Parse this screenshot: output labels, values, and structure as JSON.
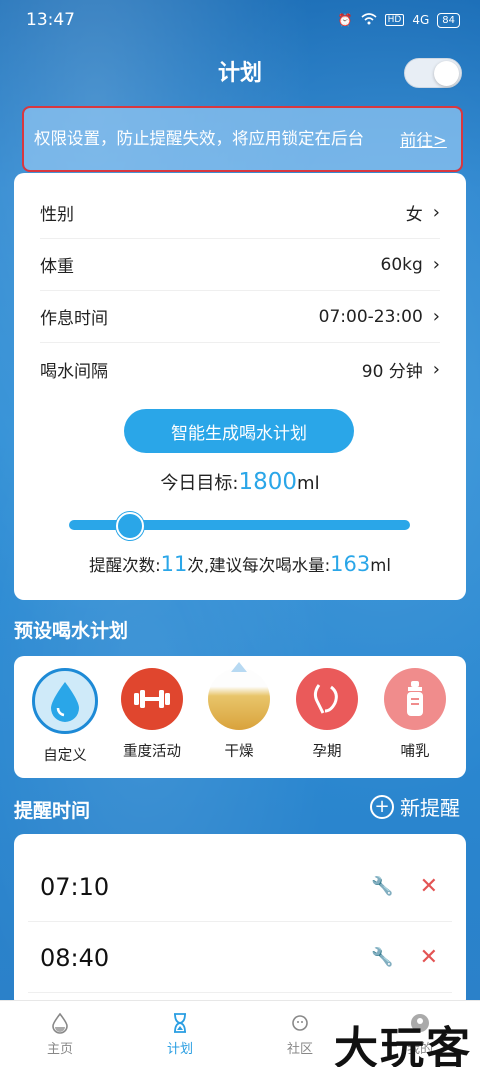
{
  "status_bar": {
    "time": "13:47",
    "network": "4G",
    "battery": "84"
  },
  "header": {
    "title": "计划",
    "toggle_on": true
  },
  "notice": {
    "text": "权限设置，防止提醒失效，将应用锁定在后台",
    "link": "前往>"
  },
  "settings": {
    "rows": [
      {
        "label": "性别",
        "value": "女"
      },
      {
        "label": "体重",
        "value": "60kg"
      },
      {
        "label": "作息时间",
        "value": "07:00-23:00"
      },
      {
        "label": "喝水间隔",
        "value": "90 分钟"
      }
    ],
    "generate_button": "智能生成喝水计划",
    "goal_label": "今日目标:",
    "goal_value": "1800",
    "goal_unit": "ml",
    "summary_prefix": "提醒次数:",
    "reminder_count": "11",
    "summary_mid": "次,建议每次喝水量:",
    "per_drink": "163",
    "summary_unit": "ml"
  },
  "presets": {
    "title": "预设喝水计划",
    "items": [
      {
        "label": "自定义",
        "icon": "water-drop-icon",
        "color": "#3aa4e6"
      },
      {
        "label": "重度活动",
        "icon": "dumbbell-icon",
        "color": "#e0462e"
      },
      {
        "label": "干燥",
        "icon": "desert-icon",
        "color": "#e8b64a"
      },
      {
        "label": "孕期",
        "icon": "pregnancy-icon",
        "color": "#ea5a5a"
      },
      {
        "label": "哺乳",
        "icon": "baby-bottle-icon",
        "color": "#f08c8c"
      }
    ]
  },
  "reminders": {
    "title": "提醒时间",
    "new_label": "新提醒",
    "items": [
      {
        "time": "07:10"
      },
      {
        "time": "08:40"
      }
    ]
  },
  "tabbar": {
    "items": [
      {
        "label": "主页",
        "icon": "drop-icon"
      },
      {
        "label": "计划",
        "icon": "hourglass-icon"
      },
      {
        "label": "社区",
        "icon": "planet-icon"
      },
      {
        "label": "我的",
        "icon": "profile-icon"
      }
    ]
  },
  "watermark": "大玩客"
}
